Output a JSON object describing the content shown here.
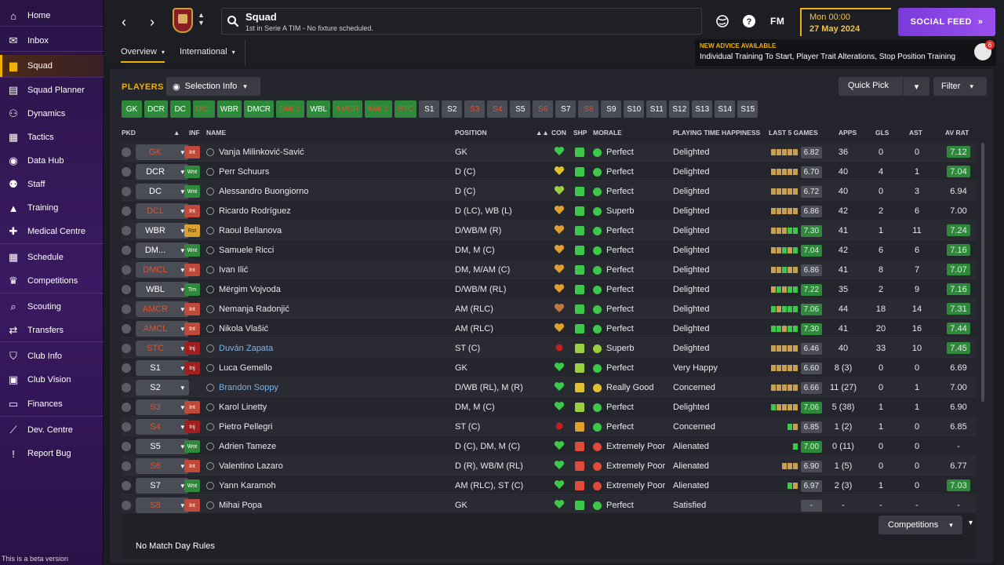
{
  "sidebar": {
    "items": [
      {
        "label": "Home",
        "icon": "house-icon",
        "glyph": "⌂",
        "active": false
      },
      {
        "label": "Inbox",
        "icon": "envelope-icon",
        "glyph": "✉",
        "active": false
      },
      {
        "label": "Squad",
        "icon": "shirt-icon",
        "glyph": "▆",
        "active": true
      },
      {
        "label": "Squad Planner",
        "icon": "clipboard-icon",
        "glyph": "▤",
        "active": false
      },
      {
        "label": "Dynamics",
        "icon": "dynamics-icon",
        "glyph": "⚇",
        "active": false
      },
      {
        "label": "Tactics",
        "icon": "tactics-board-icon",
        "glyph": "▦",
        "active": false
      },
      {
        "label": "Data Hub",
        "icon": "data-hub-icon",
        "glyph": "◉",
        "active": false
      },
      {
        "label": "Staff",
        "icon": "staff-icon",
        "glyph": "⚉",
        "active": false
      },
      {
        "label": "Training",
        "icon": "training-cone-icon",
        "glyph": "▲",
        "active": false
      },
      {
        "label": "Medical Centre",
        "icon": "medical-icon",
        "glyph": "✚",
        "active": false
      },
      {
        "label": "Schedule",
        "icon": "calendar-icon",
        "glyph": "▦",
        "active": false
      },
      {
        "label": "Competitions",
        "icon": "trophy-icon",
        "glyph": "♛",
        "active": false
      },
      {
        "label": "Scouting",
        "icon": "magnifier-icon",
        "glyph": "⌕",
        "active": false
      },
      {
        "label": "Transfers",
        "icon": "transfer-arrows-icon",
        "glyph": "⇄",
        "active": false
      },
      {
        "label": "Club Info",
        "icon": "shield-icon",
        "glyph": "⛉",
        "active": false
      },
      {
        "label": "Club Vision",
        "icon": "briefcase-icon",
        "glyph": "▣",
        "active": false
      },
      {
        "label": "Finances",
        "icon": "money-icon",
        "glyph": "▭",
        "active": false
      },
      {
        "label": "Dev. Centre",
        "icon": "dev-centre-icon",
        "glyph": "⟋",
        "active": false
      },
      {
        "label": "Report Bug",
        "icon": "alert-icon",
        "glyph": "!",
        "active": false
      }
    ],
    "beta_text": "This is a beta version"
  },
  "header": {
    "title": "Squad",
    "subtitle": "1st in Serie A TIM - No fixture scheduled.",
    "fm_label": "FM",
    "time": "Mon 00:00",
    "date": "27 May 2024",
    "social_label": "SOCIAL FEED",
    "advice_title": "NEW ADVICE AVAILABLE",
    "advice_text": "Individual Training To Start, Player Trait Alterations, Stop Position Training",
    "advice_count": "6",
    "tabs": [
      {
        "label": "Overview"
      },
      {
        "label": "International"
      }
    ]
  },
  "toolbar": {
    "players_label": "PLAYERS",
    "selection_label": "Selection Info",
    "quick_pick_label": "Quick Pick",
    "filter_label": "Filter"
  },
  "position_chips": [
    {
      "label": "GK",
      "state": "filled",
      "warn": false
    },
    {
      "label": "DCR",
      "state": "filled",
      "warn": false
    },
    {
      "label": "DC",
      "state": "filled",
      "warn": false
    },
    {
      "label": "DCL",
      "state": "filled",
      "warn": true
    },
    {
      "label": "WBR",
      "state": "filled",
      "warn": false
    },
    {
      "label": "DMCR",
      "state": "filled",
      "warn": false
    },
    {
      "label": "DMCL",
      "state": "filled",
      "warn": true
    },
    {
      "label": "WBL",
      "state": "filled",
      "warn": false
    },
    {
      "label": "AMCR",
      "state": "filled",
      "warn": true
    },
    {
      "label": "AMCL",
      "state": "filled",
      "warn": true
    },
    {
      "label": "STC",
      "state": "filled",
      "warn": true
    },
    {
      "label": "S1",
      "state": "empty",
      "warn": false
    },
    {
      "label": "S2",
      "state": "empty",
      "warn": false
    },
    {
      "label": "S3",
      "state": "empty",
      "warn": true
    },
    {
      "label": "S4",
      "state": "empty",
      "warn": true
    },
    {
      "label": "S5",
      "state": "empty",
      "warn": false
    },
    {
      "label": "S6",
      "state": "empty",
      "warn": true
    },
    {
      "label": "S7",
      "state": "empty",
      "warn": false
    },
    {
      "label": "S8",
      "state": "empty",
      "warn": true
    },
    {
      "label": "S9",
      "state": "empty",
      "warn": false
    },
    {
      "label": "S10",
      "state": "empty",
      "warn": false
    },
    {
      "label": "S11",
      "state": "empty",
      "warn": false
    },
    {
      "label": "S12",
      "state": "empty",
      "warn": false
    },
    {
      "label": "S13",
      "state": "empty",
      "warn": false
    },
    {
      "label": "S14",
      "state": "empty",
      "warn": false
    },
    {
      "label": "S15",
      "state": "empty",
      "warn": false
    }
  ],
  "columns": {
    "pkd": "PKD",
    "inf": "INF",
    "name": "NAME",
    "position": "POSITION",
    "con": "CON",
    "shp": "SHP",
    "morale": "MORALE",
    "pth": "PLAYING TIME HAPPINESS",
    "last5": "LAST 5 GAMES",
    "apps": "APPS",
    "gls": "GLS",
    "ast": "AST",
    "avrat": "AV RAT"
  },
  "colors": {
    "accent": "#f0b000",
    "good_green": "#2e8a3a",
    "warn_red": "#e0522e",
    "link_blue": "#7ab4e8",
    "social_purple": "#8a46e6"
  },
  "players": [
    {
      "pos": "GK",
      "pos_warn": true,
      "inf": "Int",
      "name": "Vanja Milinković-Savić",
      "link": false,
      "position": "GK",
      "con": "green",
      "shp": "green",
      "morale_icon": "green",
      "morale": "Perfect",
      "pth": "Delighted",
      "bars": [
        "o",
        "o",
        "o",
        "o",
        "o"
      ],
      "last5": "6.82",
      "last5_good": false,
      "apps": "36",
      "gls": "0",
      "ast": "0",
      "avrat": "7.12",
      "avrat_good": true
    },
    {
      "pos": "DCR",
      "pos_warn": false,
      "inf": "Wnt",
      "name": "Perr Schuurs",
      "link": false,
      "position": "D (C)",
      "con": "yellow",
      "shp": "green",
      "morale_icon": "green",
      "morale": "Perfect",
      "pth": "Delighted",
      "bars": [
        "o",
        "o",
        "o",
        "o",
        "o"
      ],
      "last5": "6.70",
      "last5_good": false,
      "apps": "40",
      "gls": "4",
      "ast": "1",
      "avrat": "7.04",
      "avrat_good": true
    },
    {
      "pos": "DC",
      "pos_warn": false,
      "inf": "Wnt",
      "name": "Alessandro Buongiorno",
      "link": false,
      "position": "D (C)",
      "con": "lime",
      "shp": "green",
      "morale_icon": "green",
      "morale": "Perfect",
      "pth": "Delighted",
      "bars": [
        "o",
        "o",
        "o",
        "o",
        "o"
      ],
      "last5": "6.72",
      "last5_good": false,
      "apps": "40",
      "gls": "0",
      "ast": "3",
      "avrat": "6.94",
      "avrat_good": false
    },
    {
      "pos": "DCL",
      "pos_warn": true,
      "inf": "Int",
      "name": "Ricardo Rodríguez",
      "link": false,
      "position": "D (LC), WB (L)",
      "con": "orange",
      "shp": "green",
      "morale_icon": "green",
      "morale": "Superb",
      "pth": "Delighted",
      "bars": [
        "o",
        "o",
        "o",
        "o",
        "o"
      ],
      "last5": "6.86",
      "last5_good": false,
      "apps": "42",
      "gls": "2",
      "ast": "6",
      "avrat": "7.00",
      "avrat_good": false
    },
    {
      "pos": "WBR",
      "pos_warn": false,
      "inf": "Rst",
      "name": "Raoul Bellanova",
      "link": false,
      "position": "D/WB/M (R)",
      "con": "orange",
      "shp": "green",
      "morale_icon": "green",
      "morale": "Perfect",
      "pth": "Delighted",
      "bars": [
        "o",
        "o",
        "o",
        "g",
        "g"
      ],
      "last5": "7.30",
      "last5_good": true,
      "apps": "41",
      "gls": "1",
      "ast": "11",
      "avrat": "7.24",
      "avrat_good": true
    },
    {
      "pos": "DM...",
      "pos_warn": false,
      "inf": "Wnt",
      "name": "Samuele Ricci",
      "link": false,
      "position": "DM, M (C)",
      "con": "orange",
      "shp": "green",
      "morale_icon": "green",
      "morale": "Perfect",
      "pth": "Delighted",
      "bars": [
        "o",
        "o",
        "g",
        "o",
        "g"
      ],
      "last5": "7.04",
      "last5_good": true,
      "apps": "42",
      "gls": "6",
      "ast": "6",
      "avrat": "7.16",
      "avrat_good": true
    },
    {
      "pos": "DMCL",
      "pos_warn": true,
      "inf": "Int",
      "name": "Ivan Ilić",
      "link": false,
      "position": "DM, M/AM (C)",
      "con": "orange",
      "shp": "green",
      "morale_icon": "green",
      "morale": "Perfect",
      "pth": "Delighted",
      "bars": [
        "o",
        "o",
        "g",
        "o",
        "o"
      ],
      "last5": "6.86",
      "last5_good": false,
      "apps": "41",
      "gls": "8",
      "ast": "7",
      "avrat": "7.07",
      "avrat_good": true
    },
    {
      "pos": "WBL",
      "pos_warn": false,
      "inf": "Trn",
      "name": "Mërgim Vojvoda",
      "link": false,
      "position": "D/WB/M (RL)",
      "con": "orange",
      "shp": "green",
      "morale_icon": "green",
      "morale": "Perfect",
      "pth": "Delighted",
      "bars": [
        "o",
        "g",
        "o",
        "g",
        "g"
      ],
      "last5": "7.22",
      "last5_good": true,
      "apps": "35",
      "gls": "2",
      "ast": "9",
      "avrat": "7.16",
      "avrat_good": true
    },
    {
      "pos": "AMCR",
      "pos_warn": true,
      "inf": "Int",
      "name": "Nemanja Radonjić",
      "link": false,
      "position": "AM (RLC)",
      "con": "brown",
      "shp": "green",
      "morale_icon": "green",
      "morale": "Perfect",
      "pth": "Delighted",
      "bars": [
        "g",
        "o",
        "g",
        "g",
        "g"
      ],
      "last5": "7.06",
      "last5_good": true,
      "apps": "44",
      "gls": "18",
      "ast": "14",
      "avrat": "7.31",
      "avrat_good": true
    },
    {
      "pos": "AMCL",
      "pos_warn": true,
      "inf": "Int",
      "name": "Nikola Vlašić",
      "link": false,
      "position": "AM (RLC)",
      "con": "orange",
      "shp": "green",
      "morale_icon": "green",
      "morale": "Perfect",
      "pth": "Delighted",
      "bars": [
        "g",
        "g",
        "o",
        "g",
        "g"
      ],
      "last5": "7.30",
      "last5_good": true,
      "apps": "41",
      "gls": "20",
      "ast": "16",
      "avrat": "7.44",
      "avrat_good": true
    },
    {
      "pos": "STC",
      "pos_warn": true,
      "inf": "Inj",
      "name": "Duván Zapata",
      "link": true,
      "position": "ST (C)",
      "con": "injury",
      "shp": "lime",
      "morale_icon": "lime",
      "morale": "Superb",
      "pth": "Delighted",
      "bars": [
        "o",
        "o",
        "o",
        "o",
        "o"
      ],
      "last5": "6.46",
      "last5_good": false,
      "apps": "40",
      "gls": "33",
      "ast": "10",
      "avrat": "7.45",
      "avrat_good": true
    },
    {
      "pos": "S1",
      "pos_warn": false,
      "inf": "Inj",
      "name": "Luca Gemello",
      "link": false,
      "position": "GK",
      "con": "green",
      "shp": "lime",
      "morale_icon": "green",
      "morale": "Perfect",
      "pth": "Very Happy",
      "bars": [
        "o",
        "o",
        "o",
        "o",
        "o"
      ],
      "last5": "6.60",
      "last5_good": false,
      "apps": "8 (3)",
      "gls": "0",
      "ast": "0",
      "avrat": "6.69",
      "avrat_good": false
    },
    {
      "pos": "S2",
      "pos_warn": false,
      "inf": "",
      "name": "Brandon Soppy",
      "link": true,
      "position": "D/WB (RL), M (R)",
      "con": "green",
      "shp": "yellow",
      "morale_icon": "yellow",
      "morale": "Really Good",
      "pth": "Concerned",
      "bars": [
        "o",
        "o",
        "o",
        "o",
        "o"
      ],
      "last5": "6.66",
      "last5_good": false,
      "apps": "11 (27)",
      "gls": "0",
      "ast": "1",
      "avrat": "7.00",
      "avrat_good": false
    },
    {
      "pos": "S3",
      "pos_warn": true,
      "inf": "Int",
      "name": "Karol Linetty",
      "link": false,
      "position": "DM, M (C)",
      "con": "green",
      "shp": "lime",
      "morale_icon": "green",
      "morale": "Perfect",
      "pth": "Delighted",
      "bars": [
        "g",
        "o",
        "o",
        "o",
        "o"
      ],
      "last5": "7.06",
      "last5_good": true,
      "apps": "5 (38)",
      "gls": "1",
      "ast": "1",
      "avrat": "6.90",
      "avrat_good": false
    },
    {
      "pos": "S4",
      "pos_warn": true,
      "inf": "Inj",
      "name": "Pietro Pellegri",
      "link": false,
      "position": "ST (C)",
      "con": "injury",
      "shp": "orange",
      "morale_icon": "green",
      "morale": "Perfect",
      "pth": "Concerned",
      "bars": [
        "",
        "",
        "",
        "g",
        "o"
      ],
      "last5": "6.85",
      "last5_good": false,
      "apps": "1 (2)",
      "gls": "1",
      "ast": "0",
      "avrat": "6.85",
      "avrat_good": false
    },
    {
      "pos": "S5",
      "pos_warn": false,
      "inf": "Wnt",
      "name": "Adrien Tameze",
      "link": false,
      "position": "D (C), DM, M (C)",
      "con": "green",
      "shp": "red",
      "morale_icon": "red",
      "morale": "Extremely Poor",
      "pth": "Alienated",
      "bars": [
        "",
        "",
        "",
        "",
        "g"
      ],
      "last5": "7.00",
      "last5_good": true,
      "apps": "0 (11)",
      "gls": "0",
      "ast": "0",
      "avrat": "-",
      "avrat_good": false
    },
    {
      "pos": "S6",
      "pos_warn": true,
      "inf": "Int",
      "name": "Valentino Lazaro",
      "link": false,
      "position": "D (R), WB/M (RL)",
      "con": "green",
      "shp": "red",
      "morale_icon": "red",
      "morale": "Extremely Poor",
      "pth": "Alienated",
      "bars": [
        "",
        "",
        "o",
        "o",
        "o"
      ],
      "last5": "6.90",
      "last5_good": false,
      "apps": "1 (5)",
      "gls": "0",
      "ast": "0",
      "avrat": "6.77",
      "avrat_good": false
    },
    {
      "pos": "S7",
      "pos_warn": false,
      "inf": "Wnt",
      "name": "Yann Karamoh",
      "link": false,
      "position": "AM (RLC), ST (C)",
      "con": "green",
      "shp": "red",
      "morale_icon": "red",
      "morale": "Extremely Poor",
      "pth": "Alienated",
      "bars": [
        "",
        "",
        "",
        "g",
        "o"
      ],
      "last5": "6.97",
      "last5_good": false,
      "apps": "2 (3)",
      "gls": "1",
      "ast": "0",
      "avrat": "7.03",
      "avrat_good": true
    },
    {
      "pos": "S8",
      "pos_warn": true,
      "inf": "Int",
      "name": "Mihai Popa",
      "link": false,
      "position": "GK",
      "con": "green",
      "shp": "green",
      "morale_icon": "green",
      "morale": "Perfect",
      "pth": "Satisfied",
      "bars": [
        "",
        "",
        "",
        "",
        ""
      ],
      "last5": "-",
      "last5_good": false,
      "apps": "-",
      "gls": "-",
      "ast": "-",
      "avrat": "-",
      "avrat_good": false
    }
  ],
  "footer": {
    "competitions_label": "Competitions",
    "no_rules_text": "No Match Day Rules"
  }
}
